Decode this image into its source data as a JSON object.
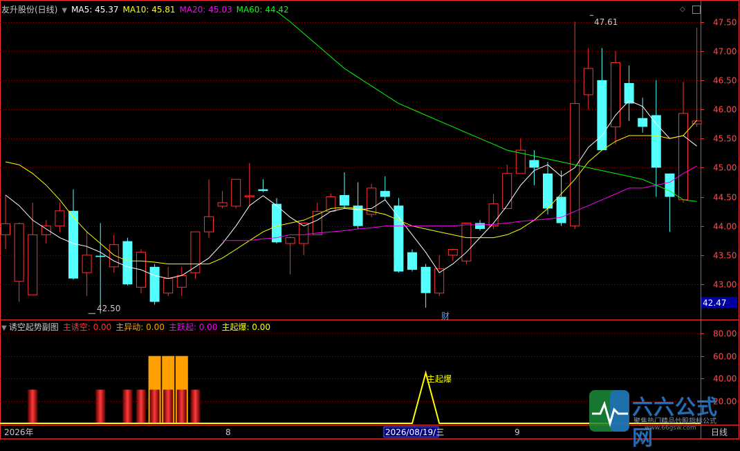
{
  "colors": {
    "up": "#ff3232",
    "down": "#54ffff",
    "ma5": "#ffffff",
    "ma10": "#ffff00",
    "ma20": "#ff00ff",
    "ma60": "#00ff00",
    "axis": "#ff3232",
    "grid": "#8c0000",
    "label": "#ff4b4b"
  },
  "main_header": {
    "title": "友升股份(日线)",
    "ma5": "MA5: 45.37",
    "ma10": "MA10: 45.81",
    "ma20": "MA20: 45.03",
    "ma60": "MA60: 44.42"
  },
  "sub_header": {
    "title": "诱空起势副图",
    "zhu_youkong": "主诱空: 0.00",
    "zhu_yidong": "主异动: 0.00",
    "zhu_yueqi": "主跃起: 0.00",
    "zhu_qibao": "主起爆: 0.00"
  },
  "icons": {
    "collapse_main": "triangle-down-icon",
    "collapse_sub": "triangle-down-icon",
    "diamond": "diamond-icon",
    "window": "window-icon"
  },
  "annotations": {
    "high": "47.61",
    "low": "42.50",
    "cai": "财",
    "qibao_label": "主起爆",
    "last_price": "42.47"
  },
  "x_axis": {
    "start": "2026年",
    "m8": "8",
    "cursor_date": "2026/08/19/三",
    "m9": "9",
    "period": "日线"
  },
  "watermark": {
    "logo": "六六公式网",
    "slogan": "聚焦热门精品炒股指标公式",
    "url": "www.66gsw.com"
  },
  "chart_data": [
    {
      "type": "candlestick",
      "title": "友升股份(日线)",
      "yticks": [
        43.0,
        43.5,
        44.0,
        44.5,
        45.0,
        45.5,
        46.0,
        46.5,
        47.0,
        47.5
      ],
      "ylim": [
        42.42,
        47.85
      ],
      "candles": [
        [
          43.85,
          44.53,
          43.6,
          44.04
        ],
        [
          43.05,
          44.06,
          42.7,
          44.04
        ],
        [
          42.82,
          44.4,
          42.82,
          43.85
        ],
        [
          43.85,
          44.1,
          43.7,
          44.0
        ],
        [
          44.0,
          44.4,
          43.9,
          44.26
        ],
        [
          44.26,
          44.63,
          43.08,
          43.1
        ],
        [
          43.2,
          43.9,
          42.8,
          43.5
        ],
        [
          43.49,
          44.05,
          42.5,
          43.47
        ],
        [
          43.3,
          43.85,
          43.2,
          43.68
        ],
        [
          43.74,
          43.8,
          42.98,
          43.0
        ],
        [
          42.95,
          43.6,
          42.85,
          43.55
        ],
        [
          43.3,
          43.35,
          42.65,
          42.7
        ],
        [
          42.85,
          43.3,
          42.8,
          43.1
        ],
        [
          42.95,
          43.3,
          42.8,
          43.15
        ],
        [
          43.2,
          43.9,
          43.1,
          43.9
        ],
        [
          43.9,
          44.8,
          43.8,
          44.16
        ],
        [
          44.34,
          44.6,
          44.3,
          44.4
        ],
        [
          44.34,
          44.8,
          44.3,
          44.8
        ],
        [
          44.5,
          45.08,
          44.35,
          44.52
        ],
        [
          44.63,
          44.8,
          44.58,
          44.6
        ],
        [
          44.38,
          44.48,
          43.7,
          43.72
        ],
        [
          43.7,
          43.82,
          43.17,
          43.8
        ],
        [
          43.7,
          43.9,
          43.5,
          44.05
        ],
        [
          43.85,
          44.4,
          43.85,
          44.25
        ],
        [
          44.25,
          44.55,
          44.25,
          44.5
        ],
        [
          44.53,
          44.92,
          44.3,
          44.35
        ],
        [
          44.35,
          44.75,
          43.95,
          44.0
        ],
        [
          44.2,
          44.72,
          44.15,
          44.65
        ],
        [
          44.6,
          44.85,
          44.45,
          44.5
        ],
        [
          44.35,
          44.48,
          43.2,
          43.22
        ],
        [
          43.55,
          43.6,
          43.22,
          43.25
        ],
        [
          43.3,
          43.35,
          42.6,
          42.85
        ],
        [
          42.85,
          43.5,
          42.8,
          43.27
        ],
        [
          43.5,
          43.6,
          43.4,
          43.6
        ],
        [
          43.4,
          44.05,
          43.35,
          44.05
        ],
        [
          44.05,
          44.1,
          43.92,
          43.95
        ],
        [
          44.0,
          44.55,
          43.95,
          44.38
        ],
        [
          44.3,
          45.05,
          44.3,
          44.9
        ],
        [
          44.9,
          45.5,
          44.9,
          45.3
        ],
        [
          45.13,
          45.3,
          44.7,
          45.0
        ],
        [
          44.9,
          45.1,
          44.2,
          44.3
        ],
        [
          44.5,
          44.95,
          44.0,
          44.05
        ],
        [
          44.0,
          47.5,
          43.95,
          46.1
        ],
        [
          46.25,
          47.05,
          46.0,
          46.7
        ],
        [
          46.5,
          47.05,
          45.45,
          45.3
        ],
        [
          45.7,
          47.0,
          45.4,
          46.8
        ],
        [
          46.45,
          46.75,
          45.8,
          46.1
        ],
        [
          45.85,
          46.2,
          45.6,
          45.7
        ],
        [
          45.9,
          46.5,
          44.5,
          45.0
        ],
        [
          44.9,
          44.9,
          43.9,
          44.5
        ],
        [
          44.45,
          46.47,
          44.4,
          45.93
        ],
        [
          45.75,
          47.4,
          45.7,
          45.8
        ]
      ],
      "series": [
        {
          "name": "MA5",
          "values": [
            44.53,
            44.35,
            44.1,
            43.95,
            43.8,
            43.7,
            43.65,
            43.55,
            43.4,
            43.3,
            43.25,
            43.15,
            43.1,
            43.15,
            43.3,
            43.45,
            43.7,
            44.0,
            44.35,
            44.52,
            44.35,
            44.15,
            44.0,
            44.1,
            44.25,
            44.3,
            44.28,
            44.3,
            44.45,
            44.15,
            43.85,
            43.55,
            43.2,
            43.35,
            43.55,
            43.8,
            44.05,
            44.35,
            44.7,
            44.95,
            45.05,
            44.85,
            45.0,
            45.35,
            45.55,
            45.9,
            46.15,
            46.05,
            45.75,
            45.5,
            45.55,
            45.37
          ]
        },
        {
          "name": "MA10",
          "values": [
            45.1,
            45.05,
            44.9,
            44.7,
            44.45,
            44.15,
            43.9,
            43.7,
            43.5,
            43.4,
            43.4,
            43.38,
            43.35,
            43.35,
            43.35,
            43.35,
            43.45,
            43.6,
            43.75,
            43.9,
            44.0,
            44.05,
            44.1,
            44.2,
            44.3,
            44.32,
            44.3,
            44.25,
            44.2,
            44.1,
            44.0,
            43.95,
            43.9,
            43.85,
            43.8,
            43.8,
            43.8,
            43.85,
            43.95,
            44.1,
            44.3,
            44.55,
            44.8,
            45.1,
            45.3,
            45.45,
            45.55,
            45.55,
            45.55,
            45.5,
            45.55,
            45.81
          ]
        },
        {
          "name": "MA20",
          "values": [
            null,
            null,
            null,
            null,
            null,
            null,
            null,
            null,
            null,
            null,
            null,
            null,
            null,
            null,
            null,
            null,
            43.75,
            43.75,
            43.75,
            43.78,
            43.8,
            43.85,
            43.85,
            43.88,
            43.9,
            43.92,
            43.95,
            43.97,
            44.0,
            44.0,
            44.0,
            44.0,
            44.0,
            44.0,
            44.02,
            44.02,
            44.03,
            44.05,
            44.08,
            44.1,
            44.12,
            44.15,
            44.25,
            44.35,
            44.45,
            44.55,
            44.65,
            44.65,
            44.7,
            44.75,
            44.9,
            45.03
          ]
        },
        {
          "name": "MA60",
          "values": [
            null,
            null,
            null,
            null,
            null,
            null,
            null,
            null,
            null,
            null,
            null,
            null,
            null,
            null,
            null,
            null,
            null,
            null,
            null,
            null,
            47.68,
            47.5,
            47.3,
            47.1,
            46.9,
            46.7,
            46.55,
            46.4,
            46.25,
            46.1,
            46.0,
            45.9,
            45.8,
            45.7,
            45.6,
            45.5,
            45.4,
            45.3,
            45.25,
            45.2,
            45.15,
            45.1,
            45.05,
            45.0,
            44.95,
            44.9,
            44.85,
            44.8,
            44.7,
            44.6,
            44.45,
            44.42
          ]
        }
      ]
    },
    {
      "type": "bar",
      "title": "诱空起势副图",
      "yticks": [
        20,
        40,
        60,
        80
      ],
      "ylim": [
        0,
        90
      ],
      "zhu_youkong": [
        {
          "index": 2,
          "value": 30
        },
        {
          "index": 7,
          "value": 30
        },
        {
          "index": 9,
          "value": 30
        },
        {
          "index": 10,
          "value": 30
        },
        {
          "index": 11,
          "value": 30
        },
        {
          "index": 12,
          "value": 30
        },
        {
          "index": 13,
          "value": 30
        },
        {
          "index": 14,
          "value": 30
        }
      ],
      "zhu_yidong": [
        {
          "index": 11,
          "value": 60
        },
        {
          "index": 12,
          "value": 60
        },
        {
          "index": 13,
          "value": 60
        }
      ],
      "zhu_qibao": {
        "baseline": 0,
        "peak_index": 31,
        "peak_value": 45
      }
    }
  ]
}
